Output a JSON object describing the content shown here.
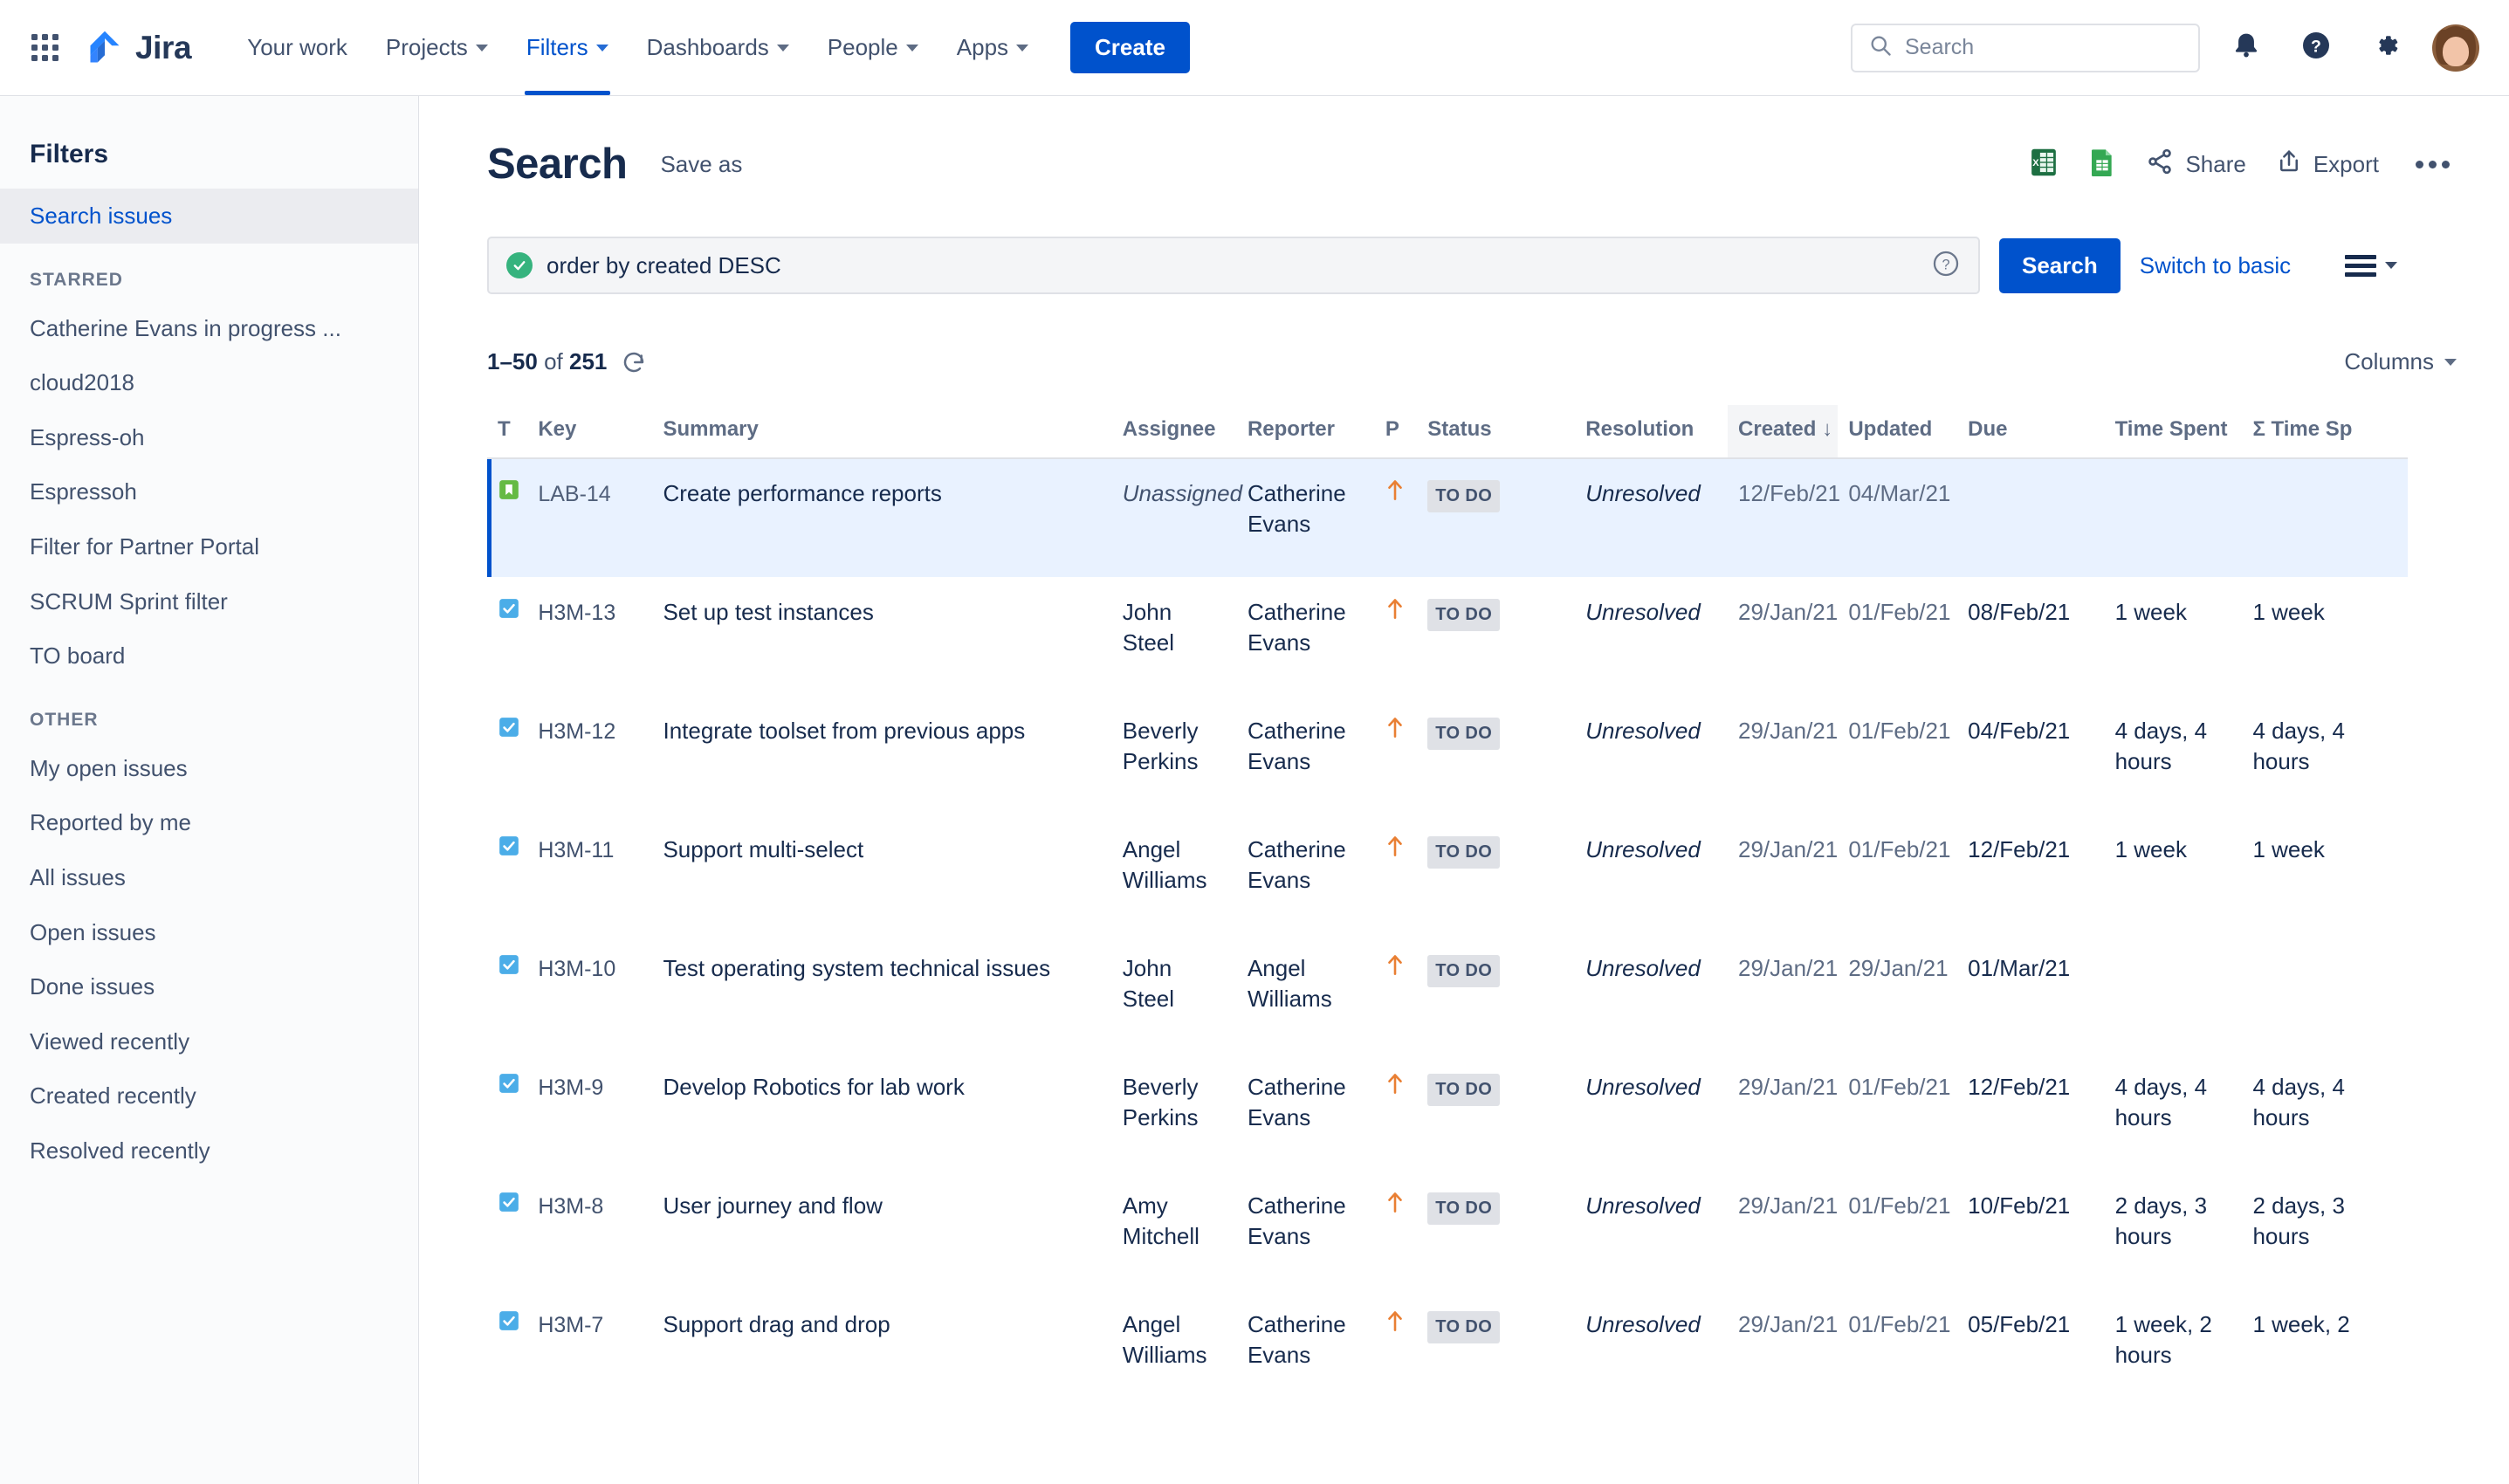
{
  "topnav": {
    "app_switcher_icon": "grid-apps-icon",
    "brand": "Jira",
    "items": [
      {
        "label": "Your work",
        "has_caret": false,
        "active": false
      },
      {
        "label": "Projects",
        "has_caret": true,
        "active": false
      },
      {
        "label": "Filters",
        "has_caret": true,
        "active": true
      },
      {
        "label": "Dashboards",
        "has_caret": true,
        "active": false
      },
      {
        "label": "People",
        "has_caret": true,
        "active": false
      },
      {
        "label": "Apps",
        "has_caret": true,
        "active": false
      }
    ],
    "create_label": "Create",
    "search_placeholder": "Search",
    "icons": [
      "notifications-icon",
      "help-icon",
      "settings-icon",
      "avatar"
    ]
  },
  "sidebar": {
    "title": "Filters",
    "selected": "Search issues",
    "primary": [
      {
        "label": "Search issues",
        "selected": true
      }
    ],
    "sections": [
      {
        "heading": "STARRED",
        "items": [
          {
            "label": "Catherine Evans in progress ..."
          },
          {
            "label": "cloud2018"
          },
          {
            "label": "Espress-oh"
          },
          {
            "label": "Espressoh"
          },
          {
            "label": "Filter for Partner Portal"
          },
          {
            "label": "SCRUM Sprint filter"
          },
          {
            "label": "TO board"
          }
        ]
      },
      {
        "heading": "OTHER",
        "items": [
          {
            "label": "My open issues"
          },
          {
            "label": "Reported by me"
          },
          {
            "label": "All issues"
          },
          {
            "label": "Open issues"
          },
          {
            "label": "Done issues"
          },
          {
            "label": "Viewed recently"
          },
          {
            "label": "Created recently"
          },
          {
            "label": "Resolved recently"
          }
        ]
      }
    ]
  },
  "page": {
    "title": "Search",
    "save_as": "Save as",
    "actions": [
      {
        "name": "export-xls-icon",
        "label": ""
      },
      {
        "name": "export-sheets-icon",
        "label": ""
      },
      {
        "name": "share",
        "label": "Share"
      },
      {
        "name": "export",
        "label": "Export"
      },
      {
        "name": "more",
        "label": ""
      }
    ]
  },
  "jql": {
    "value": "order by created DESC",
    "valid": true,
    "help_icon": "question-circle-icon",
    "search_button": "Search",
    "switch_link": "Switch to basic",
    "view_toggle_icon": "list-view-icon"
  },
  "results": {
    "range": "1–50",
    "of_word": "of",
    "total": "251",
    "refresh_icon": "refresh-icon",
    "columns_label": "Columns"
  },
  "table": {
    "columns": [
      {
        "key": "t",
        "label": "T",
        "sorted": false
      },
      {
        "key": "key",
        "label": "Key",
        "sorted": false
      },
      {
        "key": "summary",
        "label": "Summary",
        "sorted": false
      },
      {
        "key": "assignee",
        "label": "Assignee",
        "sorted": false
      },
      {
        "key": "reporter",
        "label": "Reporter",
        "sorted": false
      },
      {
        "key": "p",
        "label": "P",
        "sorted": false
      },
      {
        "key": "status",
        "label": "Status",
        "sorted": false
      },
      {
        "key": "resolution",
        "label": "Resolution",
        "sorted": false
      },
      {
        "key": "created",
        "label": "Created",
        "sorted": true,
        "sort_dir": "desc"
      },
      {
        "key": "updated",
        "label": "Updated",
        "sorted": false
      },
      {
        "key": "due",
        "label": "Due",
        "sorted": false
      },
      {
        "key": "time_spent",
        "label": "Time Spent",
        "sorted": false
      },
      {
        "key": "sum_time_spent",
        "label": "Σ Time Sp",
        "sorted": false
      }
    ],
    "rows": [
      {
        "selected": true,
        "type_icon": "story-icon",
        "key": "LAB-14",
        "summary": "Create performance reports",
        "assignee": "Unassigned",
        "assignee_unassigned": true,
        "reporter": "Catherine Evans",
        "priority": "medium-up-arrow",
        "status": "TO DO",
        "resolution": "Unresolved",
        "created": "12/Feb/21",
        "updated": "04/Mar/21",
        "due": "",
        "time_spent": "",
        "sum_time_spent": ""
      },
      {
        "selected": false,
        "type_icon": "task-icon",
        "key": "H3M-13",
        "summary": "Set up test instances",
        "assignee": "John Steel",
        "assignee_unassigned": false,
        "reporter": "Catherine Evans",
        "priority": "medium-up-arrow",
        "status": "TO DO",
        "resolution": "Unresolved",
        "created": "29/Jan/21",
        "updated": "01/Feb/21",
        "due": "08/Feb/21",
        "time_spent": "1 week",
        "sum_time_spent": "1 week"
      },
      {
        "selected": false,
        "type_icon": "task-icon",
        "key": "H3M-12",
        "summary": "Integrate toolset from previous apps",
        "assignee": "Beverly Perkins",
        "assignee_unassigned": false,
        "reporter": "Catherine Evans",
        "priority": "medium-up-arrow",
        "status": "TO DO",
        "resolution": "Unresolved",
        "created": "29/Jan/21",
        "updated": "01/Feb/21",
        "due": "04/Feb/21",
        "time_spent": "4 days, 4 hours",
        "sum_time_spent": "4 days, 4 hours"
      },
      {
        "selected": false,
        "type_icon": "task-icon",
        "key": "H3M-11",
        "summary": "Support multi-select",
        "assignee": "Angel Williams",
        "assignee_unassigned": false,
        "reporter": "Catherine Evans",
        "priority": "medium-up-arrow",
        "status": "TO DO",
        "resolution": "Unresolved",
        "created": "29/Jan/21",
        "updated": "01/Feb/21",
        "due": "12/Feb/21",
        "time_spent": "1 week",
        "sum_time_spent": "1 week"
      },
      {
        "selected": false,
        "type_icon": "task-icon",
        "key": "H3M-10",
        "summary": "Test operating system technical issues",
        "assignee": "John Steel",
        "assignee_unassigned": false,
        "reporter": "Angel Williams",
        "priority": "medium-up-arrow",
        "status": "TO DO",
        "resolution": "Unresolved",
        "created": "29/Jan/21",
        "updated": "29/Jan/21",
        "due": "01/Mar/21",
        "time_spent": "",
        "sum_time_spent": ""
      },
      {
        "selected": false,
        "type_icon": "task-icon",
        "key": "H3M-9",
        "summary": "Develop Robotics for lab work",
        "assignee": "Beverly Perkins",
        "assignee_unassigned": false,
        "reporter": "Catherine Evans",
        "priority": "medium-up-arrow",
        "status": "TO DO",
        "resolution": "Unresolved",
        "created": "29/Jan/21",
        "updated": "01/Feb/21",
        "due": "12/Feb/21",
        "time_spent": "4 days, 4 hours",
        "sum_time_spent": "4 days, 4 hours"
      },
      {
        "selected": false,
        "type_icon": "task-icon",
        "key": "H3M-8",
        "summary": "User journey and flow",
        "assignee": "Amy Mitchell",
        "assignee_unassigned": false,
        "reporter": "Catherine Evans",
        "priority": "medium-up-arrow",
        "status": "TO DO",
        "resolution": "Unresolved",
        "created": "29/Jan/21",
        "updated": "01/Feb/21",
        "due": "10/Feb/21",
        "time_spent": "2 days, 3 hours",
        "sum_time_spent": "2 days, 3 hours"
      },
      {
        "selected": false,
        "type_icon": "task-icon",
        "key": "H3M-7",
        "summary": "Support drag and drop",
        "assignee": "Angel Williams",
        "assignee_unassigned": false,
        "reporter": "Catherine Evans",
        "priority": "medium-up-arrow",
        "status": "TO DO",
        "resolution": "Unresolved",
        "created": "29/Jan/21",
        "updated": "01/Feb/21",
        "due": "05/Feb/21",
        "time_spent": "1 week, 2 hours",
        "sum_time_spent": "1 week, 2"
      }
    ]
  },
  "colors": {
    "brand_blue": "#0052CC",
    "link_blue": "#0052CC",
    "text": "#172B4D",
    "subtle_text": "#5E6C84",
    "selected_row": "#E9F2FF",
    "green_valid": "#36B37E",
    "priority_orange": "#E97F33",
    "task_blue": "#4BADE8",
    "story_green": "#65BA43"
  }
}
